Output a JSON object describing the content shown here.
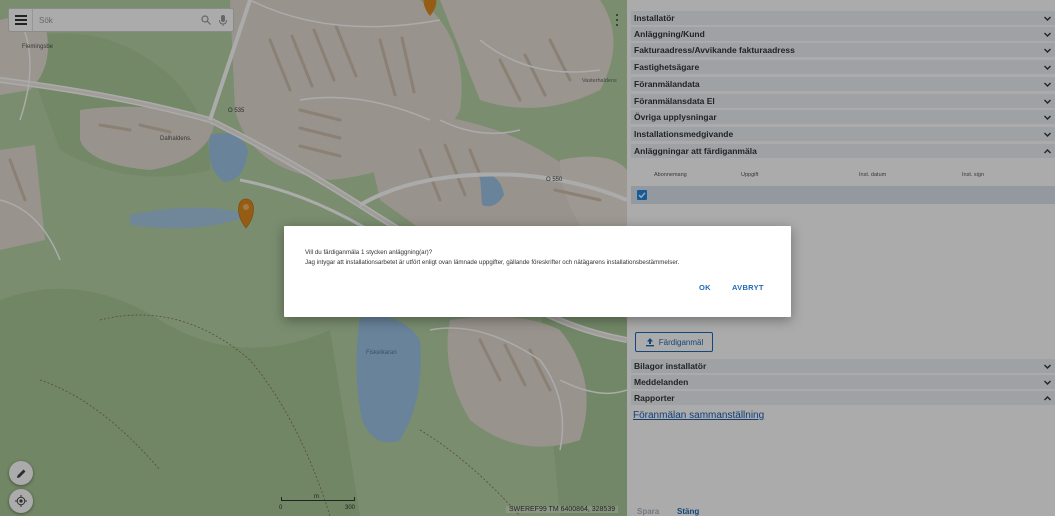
{
  "map": {
    "search": {
      "placeholder": "Sök"
    },
    "place_labels": [
      "Flemingsbe",
      "Dalhaldens.",
      "O 535",
      "O 550",
      "Vasterhaldens",
      "Fiskelkaran"
    ],
    "scale_labels": [
      "0",
      "m",
      "300"
    ],
    "coordinates": "SWEREF99 TM 6400864, 328539"
  },
  "panel": {
    "sections": [
      {
        "label": "Installatör",
        "expanded": false
      },
      {
        "label": "Anläggning/Kund",
        "expanded": false
      },
      {
        "label": "Fakturaadress/Avvikande fakturaadress",
        "expanded": false
      },
      {
        "label": "Fastighetsägare",
        "expanded": false
      },
      {
        "label": "Föranmälandata",
        "expanded": false
      },
      {
        "label": "Föranmälansdata El",
        "expanded": false
      },
      {
        "label": "Övriga upplysningar",
        "expanded": false
      },
      {
        "label": "Installationsmedgivande",
        "expanded": false
      },
      {
        "label": "Anläggningar att färdiganmäla",
        "expanded": true
      }
    ],
    "table_columns": [
      "Abonnemang",
      "Uppgift",
      "Inst. datum",
      "Inst. sign"
    ],
    "fardiganmal_button": "Färdiganmäl",
    "lower_sections": [
      {
        "label": "Bilagor installatör",
        "expanded": false
      },
      {
        "label": "Meddelanden",
        "expanded": false
      },
      {
        "label": "Rapporter",
        "expanded": true
      }
    ],
    "report_link": "Föranmälan sammanställning",
    "footer": {
      "save": "Spara",
      "close": "Stäng"
    }
  },
  "dialog": {
    "question": "Vill du färdiganmäla 1 stycken anläggning(ar)?",
    "statement": "Jag intygar att installationsarbetet är utfört enligt ovan lämnade uppgifter, gällande föreskrifter och nätägarens installationsbestämmelser.",
    "ok": "OK",
    "cancel": "AVBRYT"
  },
  "colors": {
    "accent": "#1e6bb8",
    "section_header": "#eef2f5",
    "selected_row": "#dbe5ee",
    "marker": "#e08a1e",
    "map_green": "#b7d3a6",
    "map_urban": "#e4dcd2",
    "map_water": "#9cc3e6"
  },
  "icons": {
    "menu": "hamburger-icon",
    "search": "magnifier-icon",
    "voice": "microphone-icon",
    "more": "vertical-dots-icon",
    "chevron_down": "chevron-down-icon",
    "chevron_up": "chevron-up-icon",
    "check": "checkmark-icon",
    "upload": "upload-icon",
    "edit": "pencil-icon",
    "locate": "crosshair-icon",
    "marker": "map-pin-icon"
  }
}
